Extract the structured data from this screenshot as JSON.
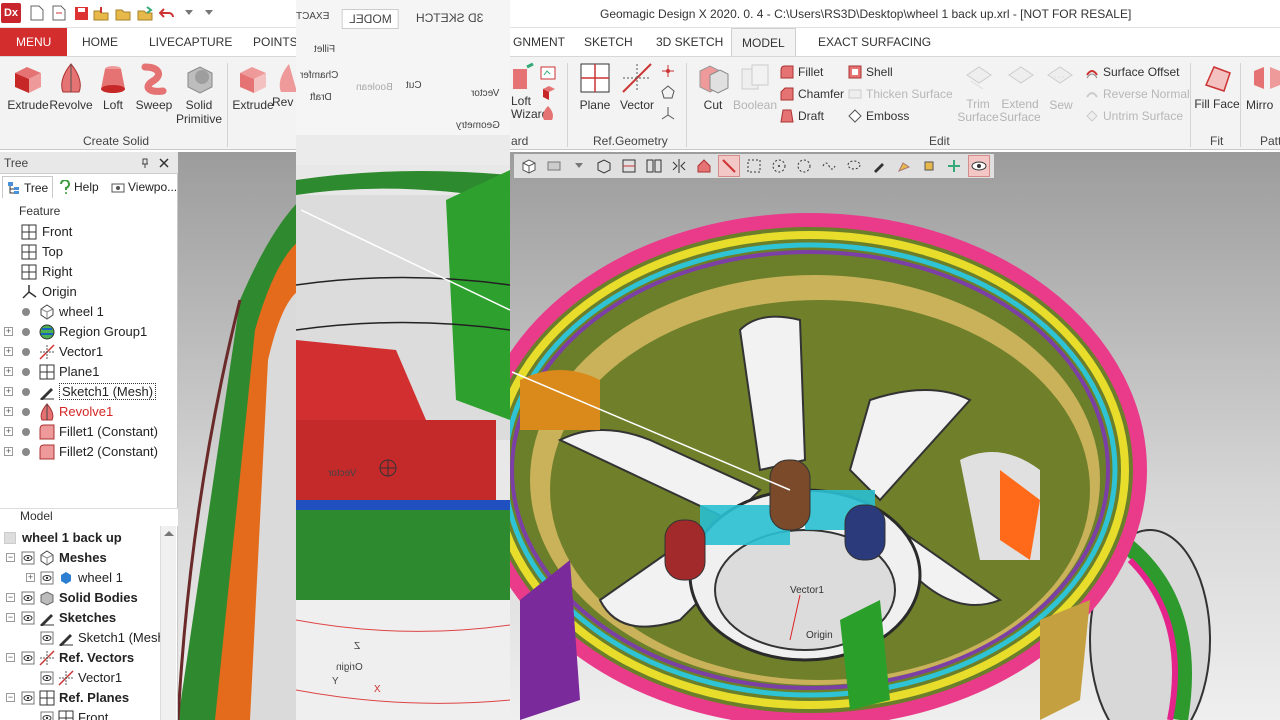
{
  "app": {
    "logo": "Dx",
    "title": "Geomagic Design X 2020. 0. 4 - C:\\Users\\RS3D\\Desktop\\wheel 1 back up.xrl - [NOT FOR RESALE]"
  },
  "quick_access": [
    "new-file-icon",
    "open-file-icon",
    "save-icon",
    "import-icon",
    "folder-icon",
    "export-icon",
    "undo-icon",
    "dropdown-icon"
  ],
  "tabs": {
    "menu": "MENU",
    "home": "HOME",
    "livecapture": "LIVECAPTURE",
    "points": "POINTS",
    "alignment": "GNMENT",
    "sketch": "SKETCH",
    "sketch3d": "3D SKETCH",
    "model": "MODEL",
    "exact_surfacing": "EXACT SURFACING"
  },
  "ribbon": {
    "create_solid": {
      "label": "Create Solid",
      "extrude": "Extrude",
      "revolve": "Revolve",
      "loft": "Loft",
      "sweep": "Sweep",
      "solid_primitive": "Solid Primitive"
    },
    "create_surface": {
      "extrude": "Extrude",
      "revolve": "Rev"
    },
    "wizard": {
      "loft": "Loft",
      "wizard": "Wizard",
      "label": "ard"
    },
    "ref_geometry": {
      "label": "Ref.Geometry",
      "plane": "Plane",
      "vector": "Vector"
    },
    "edit": {
      "label": "Edit",
      "cut": "Cut",
      "boolean": "Boolean",
      "fillet": "Fillet",
      "chamfer": "Chamfer",
      "draft": "Draft",
      "shell": "Shell",
      "thicken_surface": "Thicken Surface",
      "emboss": "Emboss",
      "trim_surface": "Trim Surface",
      "extend_surface": "Extend Surface",
      "sew": "Sew",
      "surface_offset": "Surface Offset",
      "reverse_normal": "Reverse Normal",
      "untrim_surface": "Untrim Surface"
    },
    "fit": {
      "label": "Fit",
      "fill_face": "Fill Face"
    },
    "pattern": {
      "label": "Patt",
      "mirror": "Mirro"
    }
  },
  "tree_panel": {
    "title": "Tree",
    "tabs": [
      "Tree",
      "Help",
      "Viewpo..."
    ],
    "feature_header": "Feature",
    "features": [
      {
        "label": "Front",
        "icon": "plane-icon",
        "expandable": false
      },
      {
        "label": "Top",
        "icon": "plane-icon",
        "expandable": false
      },
      {
        "label": "Right",
        "icon": "plane-icon",
        "expandable": false
      },
      {
        "label": "Origin",
        "icon": "origin-icon",
        "expandable": false
      },
      {
        "label": "wheel 1",
        "icon": "mesh-icon",
        "expandable": false
      },
      {
        "label": "Region Group1",
        "icon": "region-group-icon",
        "expandable": true
      },
      {
        "label": "Vector1",
        "icon": "vector-icon",
        "expandable": true
      },
      {
        "label": "Plane1",
        "icon": "plane-icon",
        "expandable": true
      },
      {
        "label": "Sketch1 (Mesh)",
        "icon": "sketch-icon",
        "expandable": true,
        "selected": true
      },
      {
        "label": "Revolve1",
        "icon": "revolve-icon",
        "expandable": true,
        "error": true
      },
      {
        "label": "Fillet1 (Constant)",
        "icon": "fillet-icon",
        "expandable": true
      },
      {
        "label": "Fillet2 (Constant)",
        "icon": "fillet-icon",
        "expandable": true
      }
    ]
  },
  "model_panel": {
    "title": "Model",
    "rows": [
      {
        "label": "wheel 1 back up",
        "bold": true,
        "level": 0
      },
      {
        "label": "Meshes",
        "bold": true,
        "level": 1,
        "icon": "mesh-icon"
      },
      {
        "label": "wheel 1",
        "bold": false,
        "level": 2,
        "icon": "mesh-blue-icon"
      },
      {
        "label": "Solid Bodies",
        "bold": true,
        "level": 1,
        "icon": "solid-icon"
      },
      {
        "label": "Sketches",
        "bold": true,
        "level": 1,
        "icon": "sketch-icon"
      },
      {
        "label": "Sketch1 (Mesh",
        "bold": false,
        "level": 2,
        "icon": "sketch-icon"
      },
      {
        "label": "Ref. Vectors",
        "bold": true,
        "level": 1,
        "icon": "vector-icon"
      },
      {
        "label": "Vector1",
        "bold": false,
        "level": 2,
        "icon": "vector-icon"
      },
      {
        "label": "Ref. Planes",
        "bold": true,
        "level": 1,
        "icon": "plane-icon"
      },
      {
        "label": "Front",
        "bold": false,
        "level": 2,
        "icon": "plane-icon"
      }
    ]
  },
  "viewport": {
    "labels": {
      "vector": "Vector1",
      "origin": "Origin",
      "z": "Z",
      "y": "Y",
      "x": "X",
      "mirrored_vector": "Vector"
    }
  },
  "overlay_panel": {
    "tabs": [
      "MODEL",
      "3D SKETCH",
      "EXACT"
    ],
    "buttons": [
      "Fillet",
      "Chamfer",
      "Draft",
      "Boolean",
      "Cut",
      "Vector"
    ],
    "group": "Geometry"
  },
  "colors": {
    "menu_red": "#d32d2d",
    "ribbon_bg": "#f3f3f3",
    "accent_red": "#d42626"
  }
}
